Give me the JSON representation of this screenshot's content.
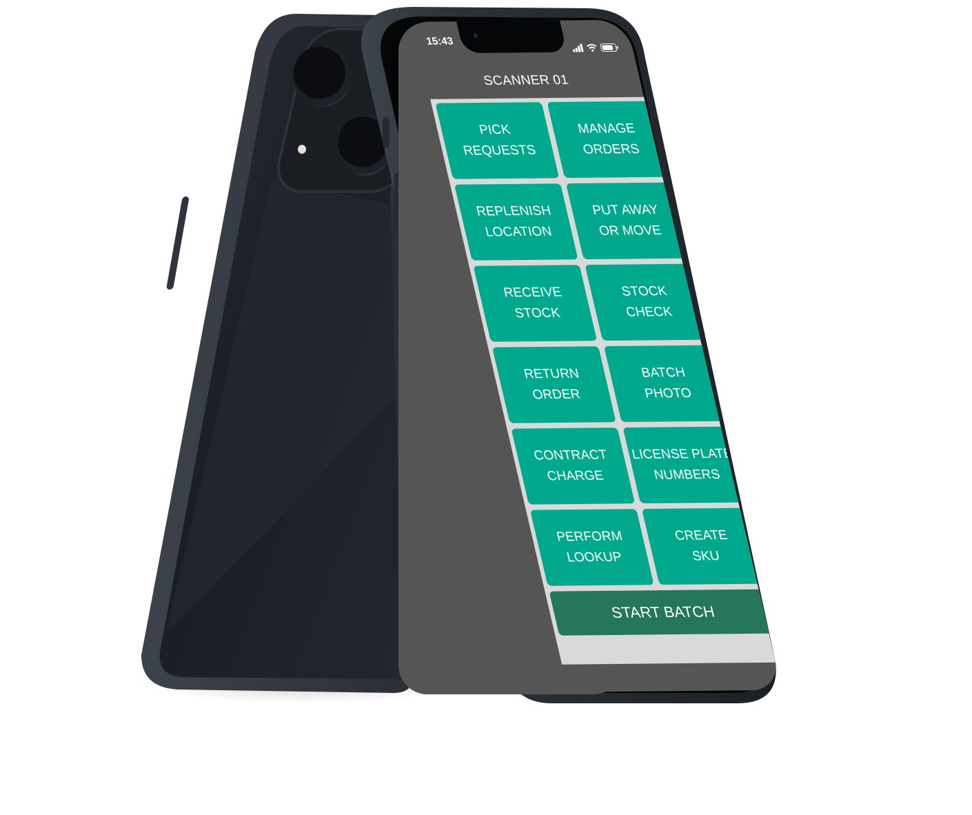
{
  "status_bar": {
    "time": "15:43",
    "icons": [
      "signal-icon",
      "wifi-icon",
      "battery-icon"
    ]
  },
  "header": {
    "title": "SCANNER 01"
  },
  "menu": {
    "items": [
      {
        "line1": "PICK",
        "line2": "REQUESTS"
      },
      {
        "line1": "MANAGE",
        "line2": "ORDERS"
      },
      {
        "line1": "REPLENISH",
        "line2": "LOCATION"
      },
      {
        "line1": "PUT AWAY",
        "line2": "OR MOVE"
      },
      {
        "line1": "RECEIVE",
        "line2": "STOCK"
      },
      {
        "line1": "STOCK",
        "line2": "CHECK"
      },
      {
        "line1": "RETURN",
        "line2": "ORDER"
      },
      {
        "line1": "BATCH",
        "line2": "PHOTO"
      },
      {
        "line1": "CONTRACT",
        "line2": "CHARGE"
      },
      {
        "line1": "LICENSE PLATE",
        "line2": "NUMBERS"
      },
      {
        "line1": "PERFORM",
        "line2": "LOOKUP"
      },
      {
        "line1": "CREATE",
        "line2": "SKU"
      }
    ],
    "primary_action": "START BATCH"
  },
  "colors": {
    "header_bg": "#555555",
    "grid_bg": "#d9d9d9",
    "tile": "#00a88e",
    "primary": "#24775a",
    "text": "#ffffff"
  }
}
